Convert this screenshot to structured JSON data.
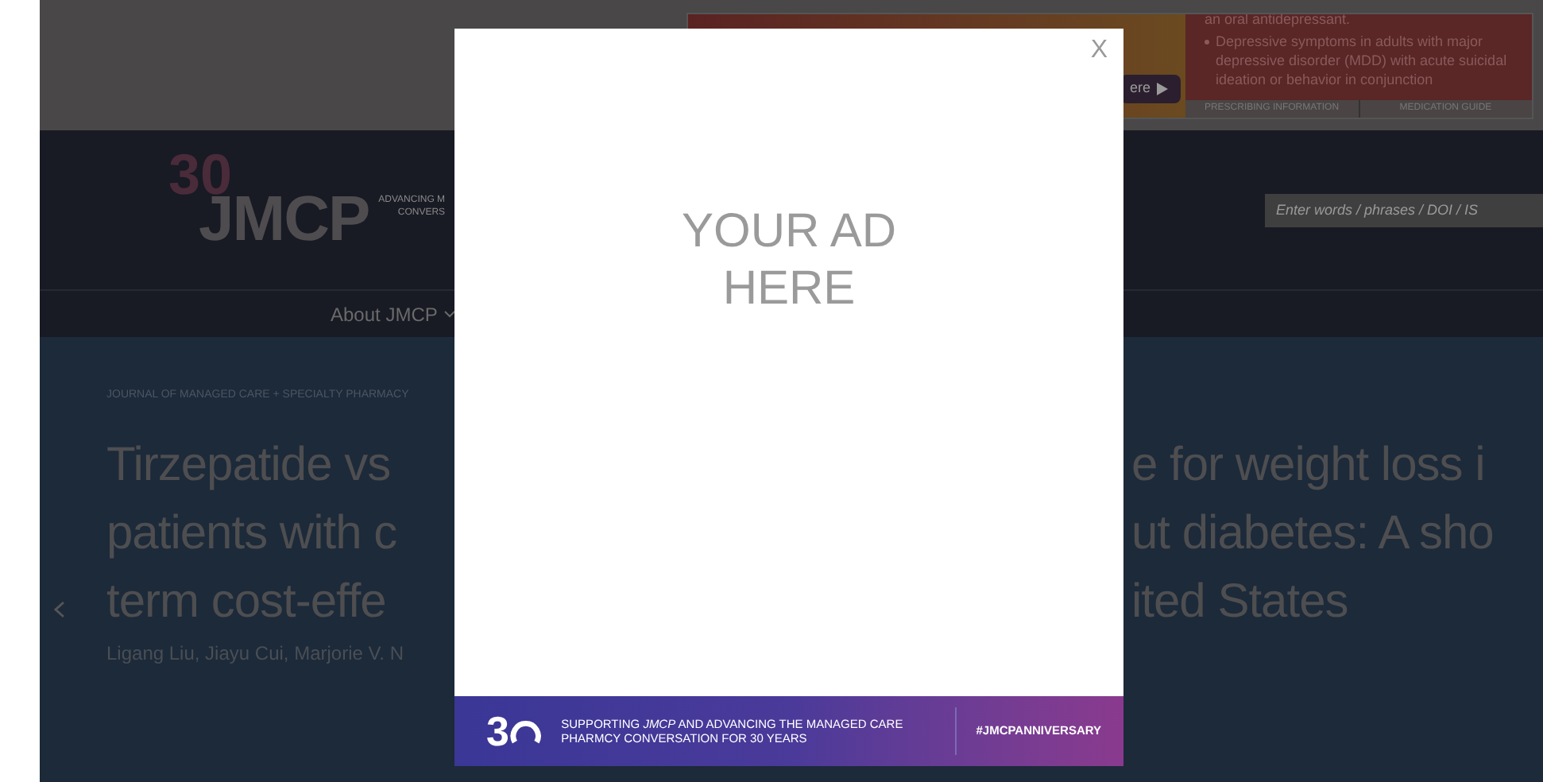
{
  "top_ad": {
    "button": "ere",
    "lines": [
      "an oral antidepressant.",
      "Depressive symptoms in adults with major depressive disorder (MDD) with acute suicidal ideation or behavior in conjunction"
    ],
    "links": [
      "PRESCRIBING INFORMATION",
      "MEDICATION GUIDE"
    ]
  },
  "header": {
    "logo": {
      "badge": "30",
      "name": "JMCP",
      "tagline_lines": [
        "ADVANCING M",
        "CONVERS"
      ]
    },
    "search": {
      "placeholder": "Enter words / phrases / DOI / IS"
    }
  },
  "nav": [
    {
      "label": "About JMCP",
      "has_dropdown": true
    }
  ],
  "article": {
    "breadcrumb": "JOURNAL OF MANAGED CARE + SPECIALTY PHARMACY",
    "title_lines": [
      {
        "left": "Tirzepatide vs",
        "right": "e for weight loss i"
      },
      {
        "left": "patients with c",
        "right": "ut diabetes: A sho"
      },
      {
        "left": "term cost-effe",
        "right": "ited States"
      }
    ],
    "authors": "Ligang Liu, Jiayu Cui, Marjorie V. N"
  },
  "modal": {
    "close": "X",
    "ad_text": "YOUR AD HERE",
    "banner": {
      "badge": "3",
      "text": "SUPPORTING *JMCP* AND ADVANCING THE MANAGED CARE PHARMCY CONVERSATION FOR 30 YEARS",
      "hashtag": "#JMCPANNIVERSARY"
    }
  }
}
